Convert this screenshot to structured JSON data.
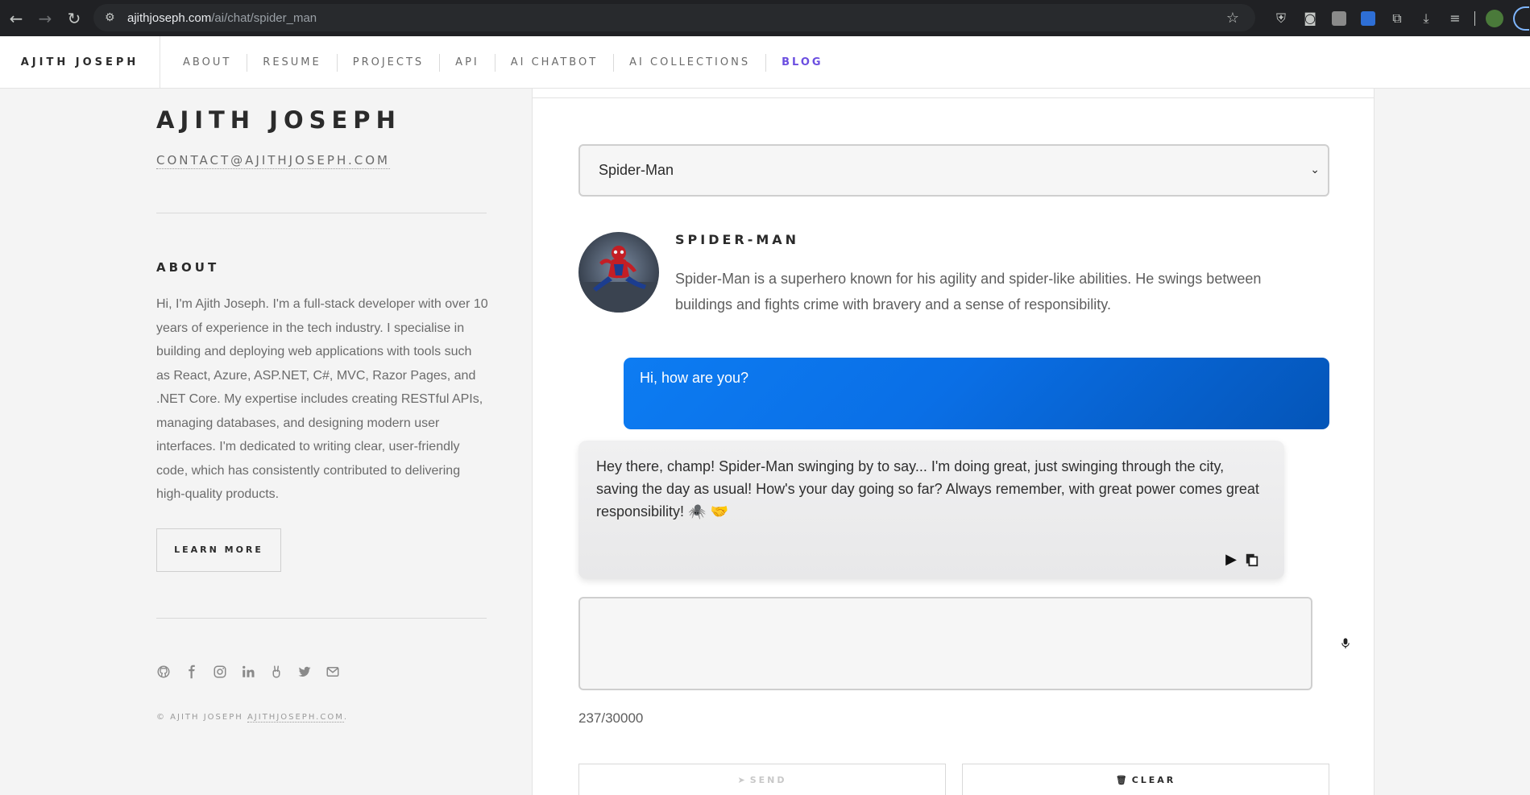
{
  "browser": {
    "url_host": "ajithjoseph.com",
    "url_path": "/ai/chat/spider_man",
    "back_icon": "back-arrow-icon",
    "forward_icon": "forward-arrow-icon",
    "reload_icon": "reload-icon"
  },
  "header": {
    "brand": "AJITH JOSEPH",
    "nav": [
      {
        "label": "ABOUT"
      },
      {
        "label": "RESUME"
      },
      {
        "label": "PROJECTS"
      },
      {
        "label": "API"
      },
      {
        "label": "AI CHATBOT"
      },
      {
        "label": "AI COLLECTIONS"
      },
      {
        "label": "BLOG"
      }
    ],
    "active_color": "#6b4ee0"
  },
  "sidebar": {
    "title": "AJITH JOSEPH",
    "email": "CONTACT@AJITHJOSEPH.COM",
    "about_heading": "ABOUT",
    "about_text": "Hi, I'm Ajith Joseph. I'm a full-stack developer with over 10 years of experience in the tech industry. I specialise in building and deploying web applications with tools such as React, Azure, ASP.NET, C#, MVC, Razor Pages, and .NET Core. My expertise includes creating RESTful APIs, managing databases, and designing modern user interfaces. I'm dedicated to writing clear, user-friendly code, which has consistently contributed to delivering high-quality products.",
    "learn_more": "LEARN MORE",
    "copyright_prefix": "© AJITH JOSEPH",
    "copyright_link": "AJITHJOSEPH.COM",
    "copyright_suffix": "."
  },
  "chat": {
    "selected_persona": "Spider-Man",
    "persona_name": "SPIDER-MAN",
    "persona_description": "Spider-Man is a superhero known for his agility and spider-like abilities. He swings between buildings and fights crime with bravery and a sense of responsibility.",
    "messages": [
      {
        "role": "user",
        "text": "Hi, how are you?"
      },
      {
        "role": "assistant",
        "text": "Hey there, champ! Spider-Man swinging by to say... I'm doing great, just swinging through the city, saving the day as usual! How's your day going so far? Always remember, with great power comes great responsibility! 🕷️ 🤝"
      }
    ],
    "input_value": "",
    "char_counter": "237/30000",
    "send_label": "SEND",
    "clear_label": "CLEAR",
    "user_bubble_color": "#0a6fe6"
  }
}
